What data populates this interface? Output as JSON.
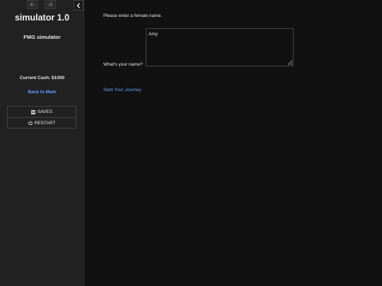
{
  "sidebar": {
    "history": {
      "back_icon": "arrow-left-icon",
      "forward_icon": "arrow-right-icon"
    },
    "toggle_icon": "chevron-left-icon",
    "title": "simulator 1.0",
    "subtitle": "FMG simulator",
    "cash_line": "Current Cash: $1000",
    "back_link": "Back to Main",
    "menu": [
      {
        "label": "SAVES",
        "icon": "floppy-disk-icon"
      },
      {
        "label": "RESTART",
        "icon": "power-icon"
      }
    ]
  },
  "passage": {
    "prompt": "Please enter a female name.",
    "name_label": "What's your name?",
    "name_value": "Amy",
    "start_link": "Start Your Journey"
  },
  "colors": {
    "sidebar_bg": "#212121",
    "main_bg": "#111111",
    "link": "#68a0ff",
    "text": "#e8e8e8"
  }
}
